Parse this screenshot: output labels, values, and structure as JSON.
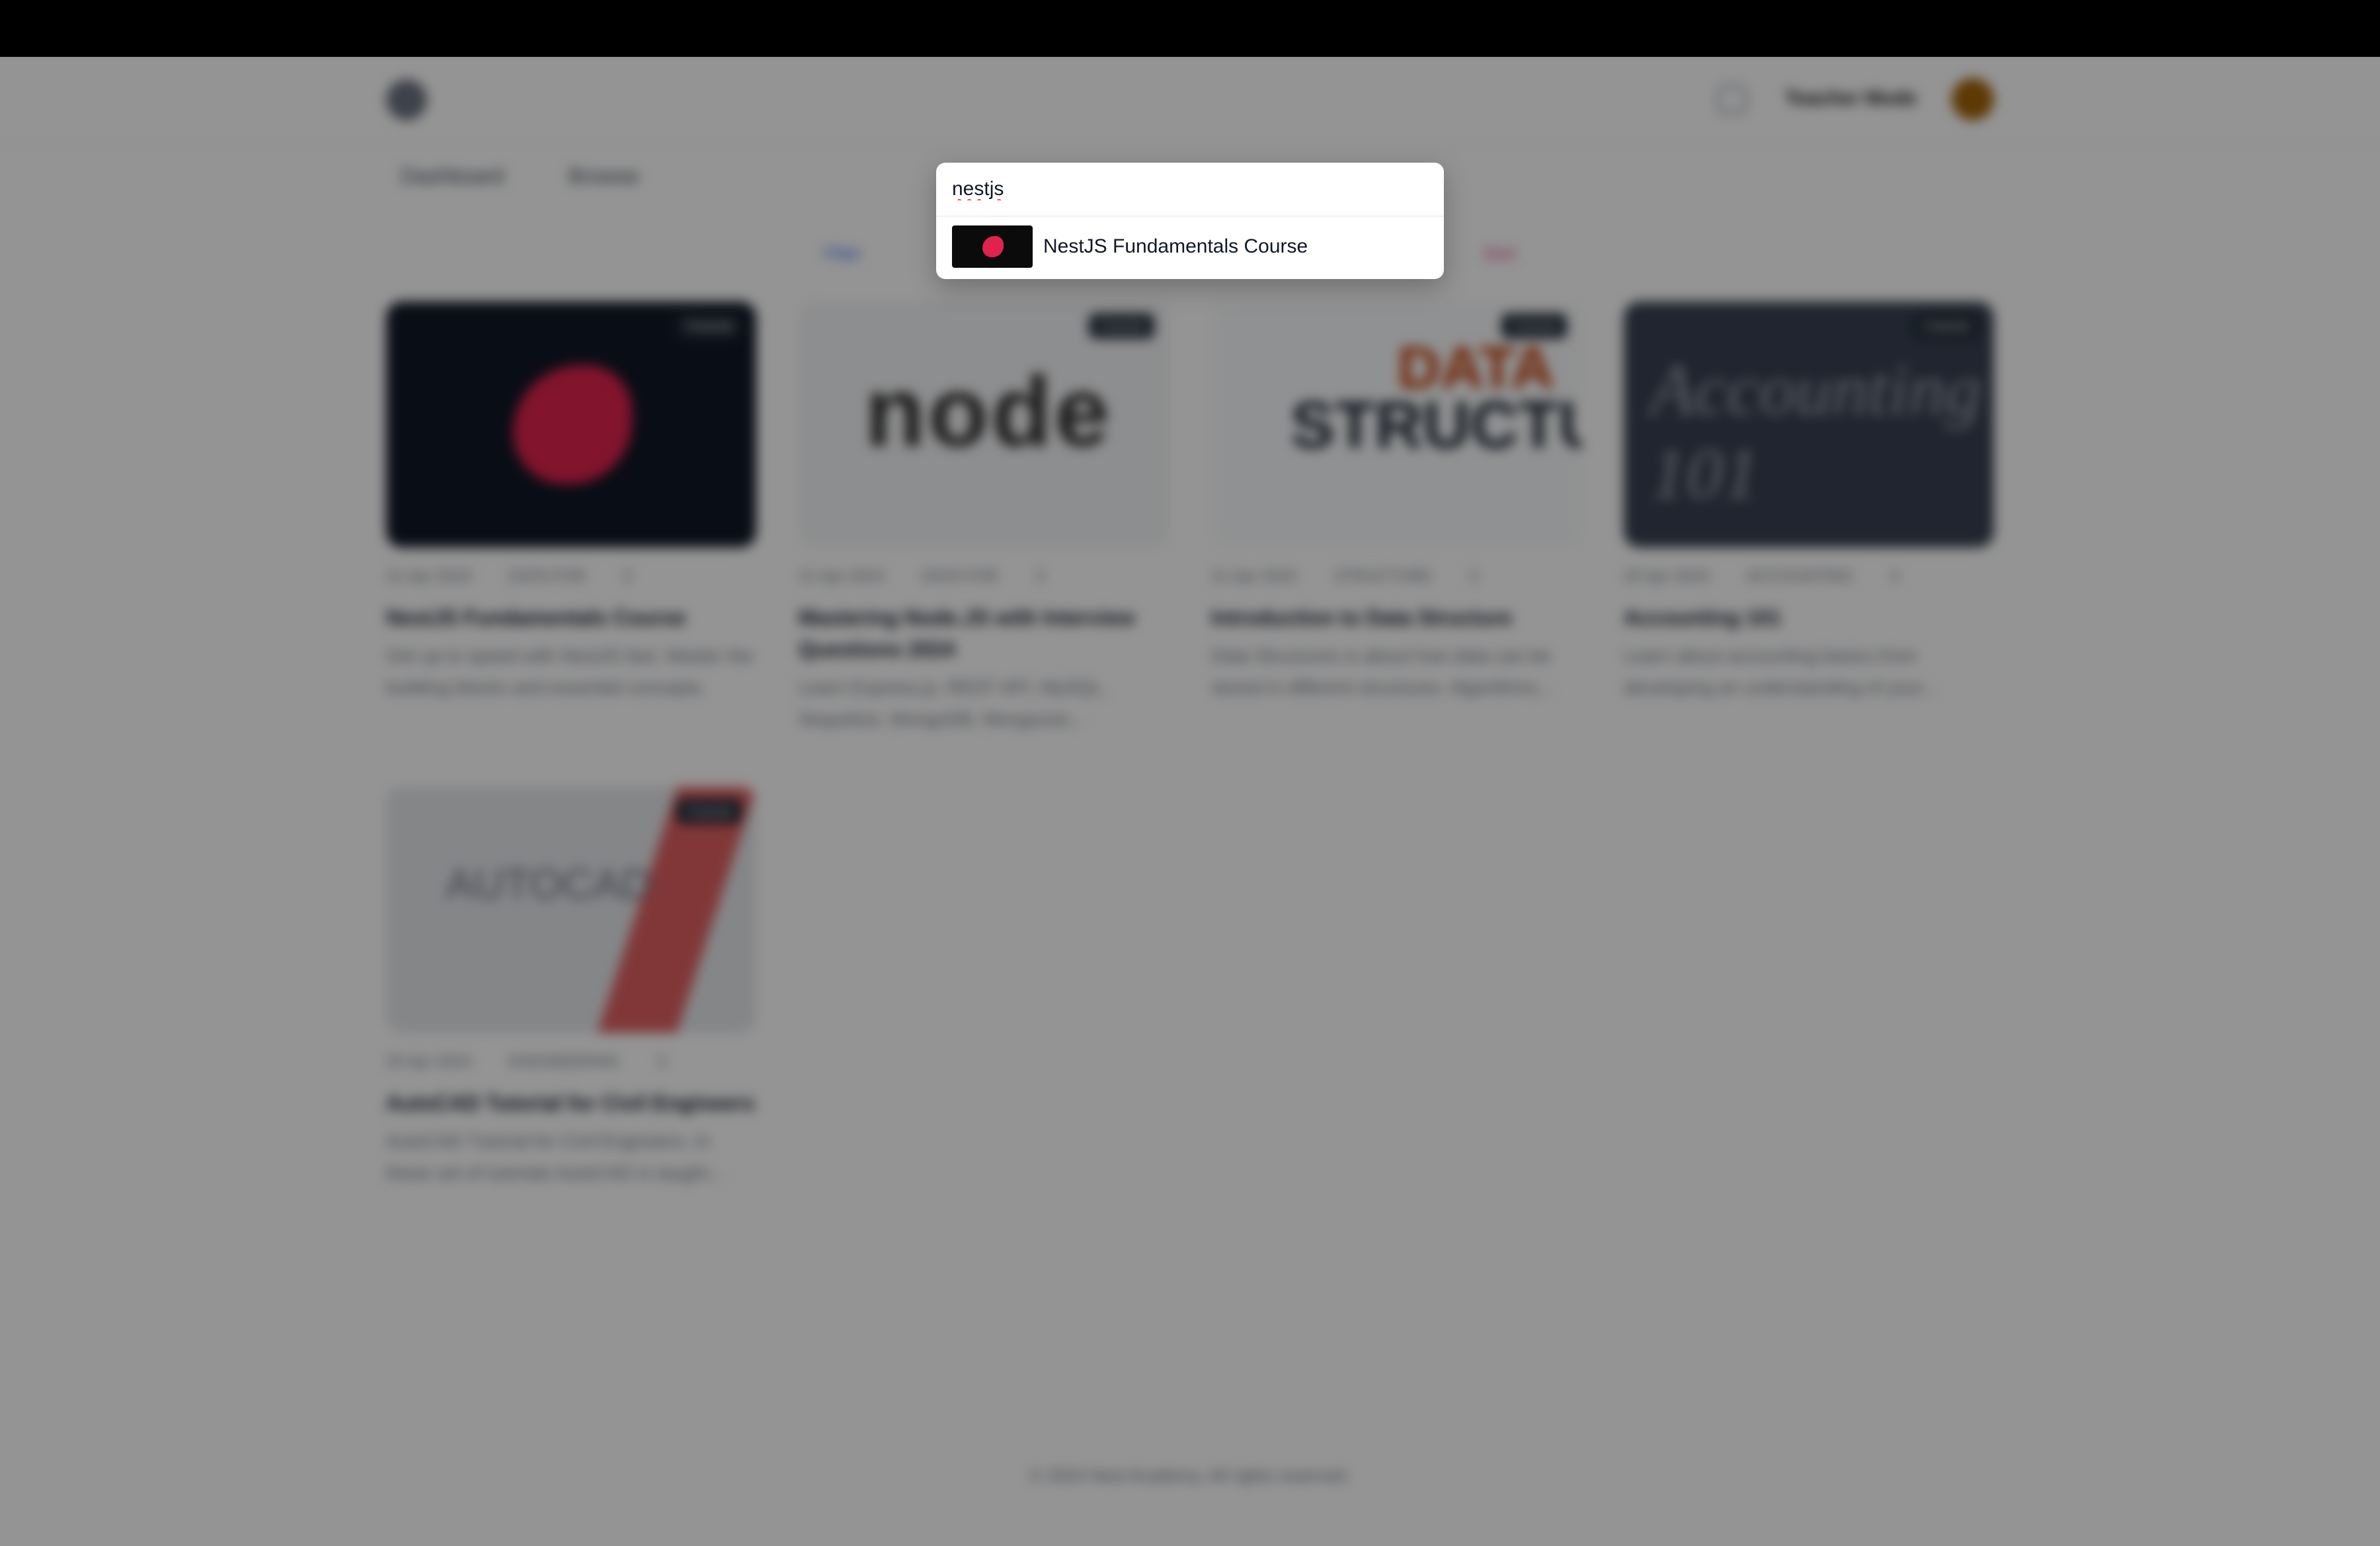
{
  "header": {
    "mode_label": "Teacher Mode"
  },
  "nav": {
    "dashboard": "Dashboard",
    "browse": "Browse"
  },
  "filters": {
    "left": "Filter",
    "right": "Sort"
  },
  "courses": [
    {
      "date": "21 Apr 2024",
      "category": "DATA FOR",
      "lessons": "3",
      "badge": "Course",
      "title": "NestJS Fundamentals Course",
      "description": "Get up to speed with NestJS fast. Master the building blocks and essential concepts."
    },
    {
      "date": "21 Apr 2024",
      "category": "DATA FOR",
      "lessons": "3",
      "badge": "Course",
      "title": "Mastering Node.JS with Interview Questions 2024",
      "description": "Learn Express.js, REST API, MySQL, Sequelize, MongoDB, Mongoose..."
    },
    {
      "date": "21 Apr 2024",
      "category": "STRUCTURE",
      "lessons": "3",
      "badge": "Course",
      "title": "Introduction to Data Structure",
      "description": "Data Structures is about how data can be stored in different structures. Algorithms..."
    },
    {
      "date": "20 Apr 2024",
      "category": "ACCOUNTING",
      "lessons": "3",
      "badge": "Course",
      "title": "Accounting 101",
      "description": "Learn about accounting basics from developing an understanding of your..."
    },
    {
      "date": "20 Apr 2024",
      "category": "ENGINEERING",
      "lessons": "3",
      "badge": "Course",
      "title": "AutoCAD Tutorial for Civil Engineers",
      "description": "AutoCAD Tutorial for Civil Engineers, In these set of tutorials AutoCAD is taught..."
    }
  ],
  "footer": {
    "text": "© 2024 Nest Academy. All rights reserved."
  },
  "search": {
    "query": "nestjs",
    "results": [
      {
        "label": "NestJS Fundamentals Course",
        "thumbnail_icon": "nestjs-logo-icon"
      }
    ]
  }
}
